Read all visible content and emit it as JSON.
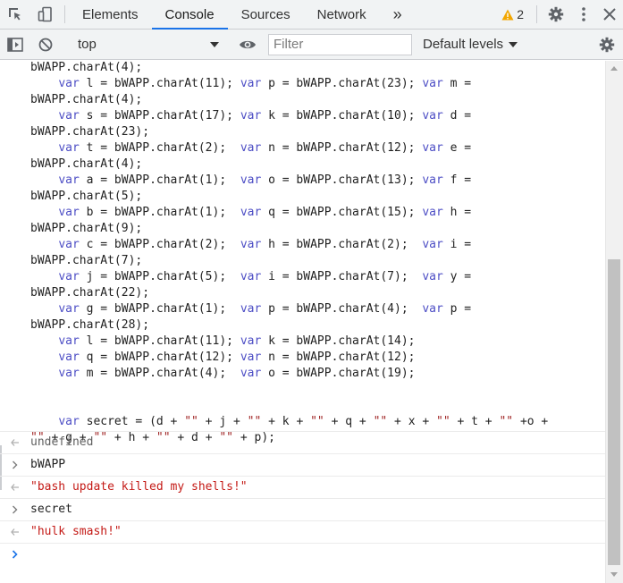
{
  "tabs": [
    {
      "label": "Elements"
    },
    {
      "label": "Console"
    },
    {
      "label": "Sources"
    },
    {
      "label": "Network"
    }
  ],
  "more_tabs_glyph": "»",
  "warning_count": "2",
  "context_select": {
    "value": "top"
  },
  "filter": {
    "placeholder": "Filter",
    "value": ""
  },
  "levels": {
    "label": "Default levels"
  },
  "accent_color": "#1a73e8",
  "code_lines": [
    [
      {
        "t": "bWAPP.charAt(4);"
      }
    ],
    [
      {
        "t": "    "
      },
      {
        "t": "var",
        "c": "kw"
      },
      {
        "t": " l = bWAPP.charAt(11); "
      },
      {
        "t": "var",
        "c": "kw"
      },
      {
        "t": " p = bWAPP.charAt(23); "
      },
      {
        "t": "var",
        "c": "kw"
      },
      {
        "t": " m ="
      }
    ],
    [
      {
        "t": "bWAPP.charAt(4);"
      }
    ],
    [
      {
        "t": "    "
      },
      {
        "t": "var",
        "c": "kw"
      },
      {
        "t": " s = bWAPP.charAt(17); "
      },
      {
        "t": "var",
        "c": "kw"
      },
      {
        "t": " k = bWAPP.charAt(10); "
      },
      {
        "t": "var",
        "c": "kw"
      },
      {
        "t": " d ="
      }
    ],
    [
      {
        "t": "bWAPP.charAt(23);"
      }
    ],
    [
      {
        "t": "    "
      },
      {
        "t": "var",
        "c": "kw"
      },
      {
        "t": " t = bWAPP.charAt(2);  "
      },
      {
        "t": "var",
        "c": "kw"
      },
      {
        "t": " n = bWAPP.charAt(12); "
      },
      {
        "t": "var",
        "c": "kw"
      },
      {
        "t": " e ="
      }
    ],
    [
      {
        "t": "bWAPP.charAt(4);"
      }
    ],
    [
      {
        "t": "    "
      },
      {
        "t": "var",
        "c": "kw"
      },
      {
        "t": " a = bWAPP.charAt(1);  "
      },
      {
        "t": "var",
        "c": "kw"
      },
      {
        "t": " o = bWAPP.charAt(13); "
      },
      {
        "t": "var",
        "c": "kw"
      },
      {
        "t": " f ="
      }
    ],
    [
      {
        "t": "bWAPP.charAt(5);"
      }
    ],
    [
      {
        "t": "    "
      },
      {
        "t": "var",
        "c": "kw"
      },
      {
        "t": " b = bWAPP.charAt(1);  "
      },
      {
        "t": "var",
        "c": "kw"
      },
      {
        "t": " q = bWAPP.charAt(15); "
      },
      {
        "t": "var",
        "c": "kw"
      },
      {
        "t": " h ="
      }
    ],
    [
      {
        "t": "bWAPP.charAt(9);"
      }
    ],
    [
      {
        "t": "    "
      },
      {
        "t": "var",
        "c": "kw"
      },
      {
        "t": " c = bWAPP.charAt(2);  "
      },
      {
        "t": "var",
        "c": "kw"
      },
      {
        "t": " h = bWAPP.charAt(2);  "
      },
      {
        "t": "var",
        "c": "kw"
      },
      {
        "t": " i ="
      }
    ],
    [
      {
        "t": "bWAPP.charAt(7);"
      }
    ],
    [
      {
        "t": "    "
      },
      {
        "t": "var",
        "c": "kw"
      },
      {
        "t": " j = bWAPP.charAt(5);  "
      },
      {
        "t": "var",
        "c": "kw"
      },
      {
        "t": " i = bWAPP.charAt(7);  "
      },
      {
        "t": "var",
        "c": "kw"
      },
      {
        "t": " y ="
      }
    ],
    [
      {
        "t": "bWAPP.charAt(22);"
      }
    ],
    [
      {
        "t": "    "
      },
      {
        "t": "var",
        "c": "kw"
      },
      {
        "t": " g = bWAPP.charAt(1);  "
      },
      {
        "t": "var",
        "c": "kw"
      },
      {
        "t": " p = bWAPP.charAt(4);  "
      },
      {
        "t": "var",
        "c": "kw"
      },
      {
        "t": " p ="
      }
    ],
    [
      {
        "t": "bWAPP.charAt(28);"
      }
    ],
    [
      {
        "t": "    "
      },
      {
        "t": "var",
        "c": "kw"
      },
      {
        "t": " l = bWAPP.charAt(11); "
      },
      {
        "t": "var",
        "c": "kw"
      },
      {
        "t": " k = bWAPP.charAt(14);"
      }
    ],
    [
      {
        "t": "    "
      },
      {
        "t": "var",
        "c": "kw"
      },
      {
        "t": " q = bWAPP.charAt(12); "
      },
      {
        "t": "var",
        "c": "kw"
      },
      {
        "t": " n = bWAPP.charAt(12);"
      }
    ],
    [
      {
        "t": "    "
      },
      {
        "t": "var",
        "c": "kw"
      },
      {
        "t": " m = bWAPP.charAt(4);  "
      },
      {
        "t": "var",
        "c": "kw"
      },
      {
        "t": " o = bWAPP.charAt(19);"
      }
    ],
    [
      {
        "t": ""
      }
    ],
    [
      {
        "t": ""
      }
    ],
    [
      {
        "t": "    "
      },
      {
        "t": "var",
        "c": "kw"
      },
      {
        "t": " secret = (d + "
      },
      {
        "t": "\"\"",
        "c": "str"
      },
      {
        "t": " + j + "
      },
      {
        "t": "\"\"",
        "c": "str"
      },
      {
        "t": " + k + "
      },
      {
        "t": "\"\"",
        "c": "str"
      },
      {
        "t": " + q + "
      },
      {
        "t": "\"\"",
        "c": "str"
      },
      {
        "t": " + x + "
      },
      {
        "t": "\"\"",
        "c": "str"
      },
      {
        "t": " + t + "
      },
      {
        "t": "\"\"",
        "c": "str"
      },
      {
        "t": " +o +"
      }
    ],
    [
      {
        "t": "\"\"",
        "c": "str"
      },
      {
        "t": " + g + "
      },
      {
        "t": "\"\"",
        "c": "str"
      },
      {
        "t": " + h + "
      },
      {
        "t": "\"\"",
        "c": "str"
      },
      {
        "t": " + d + "
      },
      {
        "t": "\"\"",
        "c": "str"
      },
      {
        "t": " + p);"
      }
    ]
  ],
  "messages": {
    "result1": "undefined",
    "input1": "bWAPP",
    "result2": "\"bash update killed my shells!\"",
    "input2": "secret",
    "result3": "\"hulk smash!\""
  }
}
